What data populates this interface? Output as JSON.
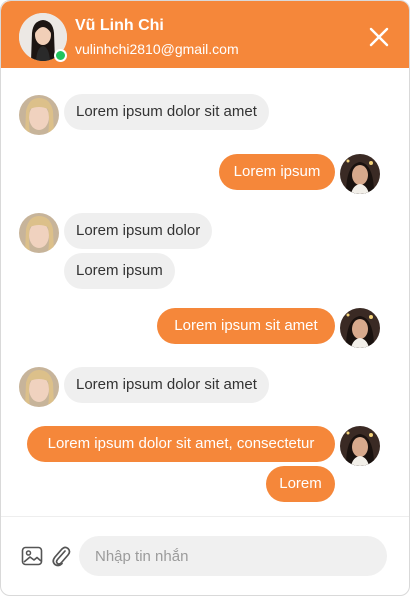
{
  "header": {
    "name": "Vũ Linh Chi",
    "email": "vulinhchi2810@gmail.com",
    "online": true,
    "avatar_icon": "user-avatar-photo",
    "close_icon": "close-icon"
  },
  "messages": [
    {
      "from": "other",
      "text": "Lorem ipsum dolor sit amet"
    },
    {
      "from": "me",
      "text": "Lorem ipsum"
    },
    {
      "from": "other",
      "text": "Lorem ipsum dolor"
    },
    {
      "from": "other",
      "text": "Lorem ipsum"
    },
    {
      "from": "me",
      "text": "Lorem ipsum sit amet"
    },
    {
      "from": "other",
      "text": "Lorem ipsum dolor sit amet"
    },
    {
      "from": "me",
      "text": "Lorem ipsum dolor sit amet, consectetur"
    },
    {
      "from": "me",
      "text": "Lorem"
    }
  ],
  "composer": {
    "placeholder": "Nhập tin nhắn",
    "image_icon": "image-icon",
    "attach_icon": "paperclip-icon"
  },
  "colors": {
    "accent": "#f5873a",
    "incoming_bubble": "#efefef",
    "online": "#22c55e"
  }
}
